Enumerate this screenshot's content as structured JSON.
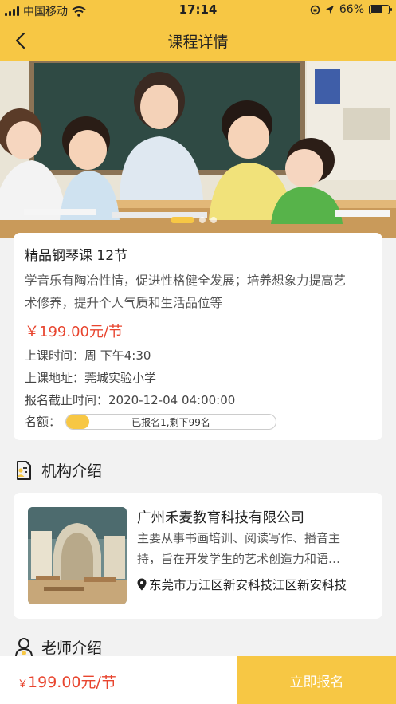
{
  "status_bar": {
    "carrier": "中国移动",
    "time": "17:14",
    "battery": "66%",
    "battery_level": 0.66
  },
  "nav": {
    "title": "课程详情",
    "back_icon": "chevron-left-icon"
  },
  "hero": {
    "image": "classroom-teacher-children-photo",
    "slide_count": 3,
    "active_slide": 1
  },
  "course": {
    "title": "精品钢琴课 12节",
    "desc_line1": "学音乐有陶冶性情，促进性格健全发展；培养想象力提高艺",
    "desc_line2": "术修养，提升个人气质和生活品位等",
    "price": "￥199.00元/节",
    "time_line": "上课时间：周 下午4:30",
    "address_line": "上课地址：莞城实验小学",
    "deadline_line": "报名截止时间：2020-12-04 04:00:00",
    "quota_label": "名额：",
    "quota_text": "已报名1,剩下99名",
    "quota_fraction": 0.01
  },
  "org_section": {
    "title": "机构介绍",
    "icon": "document-user-icon",
    "name": "广州禾麦教育科技有限公司",
    "desc_line1": "主要从事书画培训、阅读写作、播音主",
    "desc_line2": "持，旨在开发学生的艺术创造力和语…",
    "address": "东莞市万江区新安科技江区新安科技",
    "address_icon": "location-pin-icon"
  },
  "teacher_section": {
    "title": "老师介绍",
    "icon": "person-icon"
  },
  "bottom_bar": {
    "currency": "￥",
    "price": "199.00元/节",
    "enroll_label": "立即报名"
  },
  "colors": {
    "accent": "#f7c744",
    "price": "#e8452f",
    "background": "#f2f2f2"
  }
}
